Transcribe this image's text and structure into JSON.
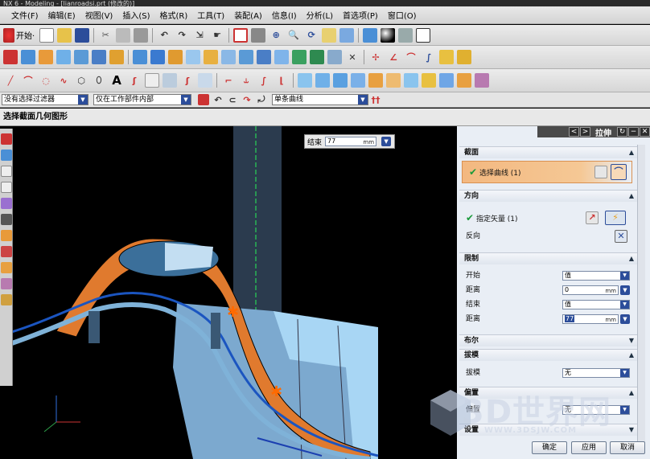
{
  "window": {
    "title": "NX 6 - Modeling - [lianroadsi.prt (修改的)]"
  },
  "menubar": {
    "items": [
      "文件(F)",
      "编辑(E)",
      "视图(V)",
      "插入(S)",
      "格式(R)",
      "工具(T)",
      "装配(A)",
      "信息(I)",
      "分析(L)",
      "首选项(P)",
      "窗口(O)"
    ]
  },
  "toolbar1": {
    "start_label": "开始·"
  },
  "filterbar": {
    "type_filter": "没有选择过滤器",
    "scope_filter": "仅在工作部件内部",
    "curve_rule": "单条曲线"
  },
  "status": {
    "prompt": "选择截面几何图形"
  },
  "end_popup": {
    "label": "结束",
    "value": "77",
    "unit": "mm"
  },
  "panel": {
    "title": "拉伸",
    "sections": {
      "section": {
        "label": "截面",
        "select_curve": "选择曲线 (1)"
      },
      "direction": {
        "label": "方向",
        "specify_vector": "指定矢量 (1)",
        "reverse": "反向"
      },
      "limits": {
        "label": "限制",
        "start_label": "开始",
        "start_value": "值",
        "start_distance_label": "距离",
        "start_distance_value": "0",
        "start_unit": "mm",
        "end_label": "结束",
        "end_value": "值",
        "end_distance_label": "距离",
        "end_distance_value": "77",
        "end_unit": "mm"
      },
      "boolean": {
        "label": "布尔"
      },
      "draft": {
        "label": "拔模",
        "draft_label": "拔模",
        "draft_value": "无"
      },
      "offset": {
        "label": "偏置",
        "offset_label": "偏置",
        "offset_value": "无"
      },
      "settings": {
        "label": "设置"
      }
    },
    "buttons": {
      "ok": "确定",
      "apply": "应用",
      "cancel": "取消"
    }
  },
  "watermark": {
    "text": "3D世界网",
    "url": "WWW.3DSJW.COM"
  },
  "colors": {
    "accent": "#2c4d9a",
    "selection_highlight": "#f0b072",
    "model_orange": "#e07a2e",
    "model_blue": "#6cb5e6"
  }
}
